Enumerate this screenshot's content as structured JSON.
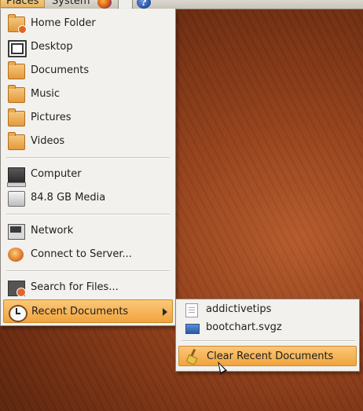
{
  "panel": {
    "places_label": "Places",
    "system_label": "System",
    "launchers": [
      "firefox-icon",
      "mail-icon",
      "help-icon"
    ],
    "help_glyph": "?"
  },
  "places_menu": {
    "items": [
      {
        "label": "Home Folder",
        "icon": "home-folder-icon"
      },
      {
        "label": "Desktop",
        "icon": "desktop-icon"
      },
      {
        "label": "Documents",
        "icon": "folder-icon"
      },
      {
        "label": "Music",
        "icon": "folder-icon"
      },
      {
        "label": "Pictures",
        "icon": "folder-icon"
      },
      {
        "label": "Videos",
        "icon": "folder-icon"
      },
      {
        "label": "Computer",
        "icon": "computer-icon"
      },
      {
        "label": "84.8 GB Media",
        "icon": "drive-icon"
      },
      {
        "label": "Network",
        "icon": "network-icon"
      },
      {
        "label": "Connect to Server...",
        "icon": "server-icon"
      },
      {
        "label": "Search for Files...",
        "icon": "search-icon"
      },
      {
        "label": "Recent Documents",
        "icon": "clock-icon",
        "has_submenu": true,
        "highlighted": true
      }
    ]
  },
  "recent_documents": {
    "items": [
      {
        "label": "addictivetips",
        "icon": "text-document-icon"
      },
      {
        "label": "bootchart.svgz",
        "icon": "image-file-icon"
      }
    ],
    "clear_label": "Clear Recent Documents"
  },
  "colors": {
    "highlight": "#f0a43c",
    "menu_background": "#f2f1ee",
    "desktop": "#93401a"
  }
}
